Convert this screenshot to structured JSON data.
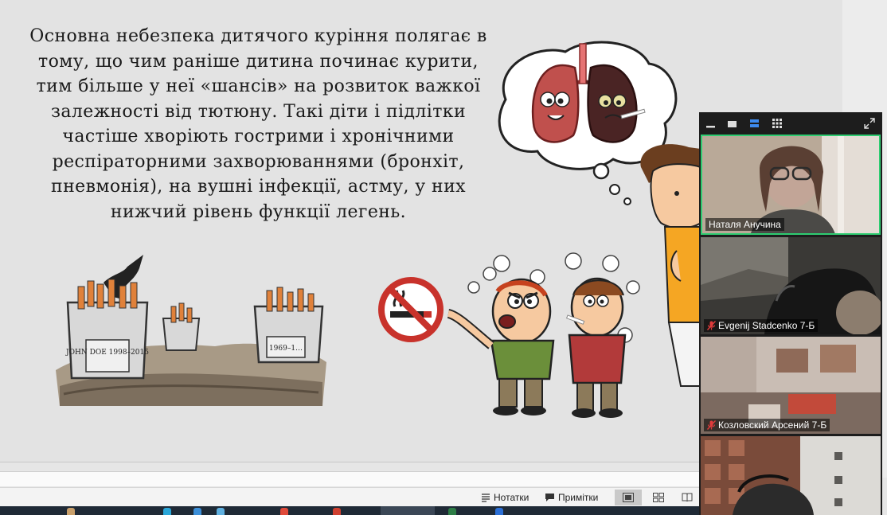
{
  "slide": {
    "text": "Основна небезпека дитячого куріння полягає в тому, що чим раніше дитина починає курити, тим більше у неї «шансів» на розвиток важкої залежності від тютюну. Такі діти і підлітки частіше хворіють гострими і хронічними респіраторними захворюваннями (бронхіт, пневмонія), на вушні інфекції, астму, у них нижчий рівень функції легень.",
    "gravestones": [
      "JOHN DOE 1998–2015",
      "1969–1…"
    ]
  },
  "status_bar": {
    "notes_label": "Нотатки",
    "comments_label": "Примітки"
  },
  "video_panel": {
    "participants": [
      {
        "name": "Наталя Анучина",
        "muted": false,
        "active": true
      },
      {
        "name": "Evgenij Stadcenko 7-Б",
        "muted": true,
        "active": false
      },
      {
        "name": "Козловский Арсений 7-Б",
        "muted": true,
        "active": false
      },
      {
        "name": "",
        "muted": false,
        "active": false
      }
    ]
  },
  "colors": {
    "active_speaker": "#2ecc71",
    "muted_mic": "#e03b3b",
    "panel_bg": "#1d1d1d",
    "taskbar": "#1f2a36"
  }
}
